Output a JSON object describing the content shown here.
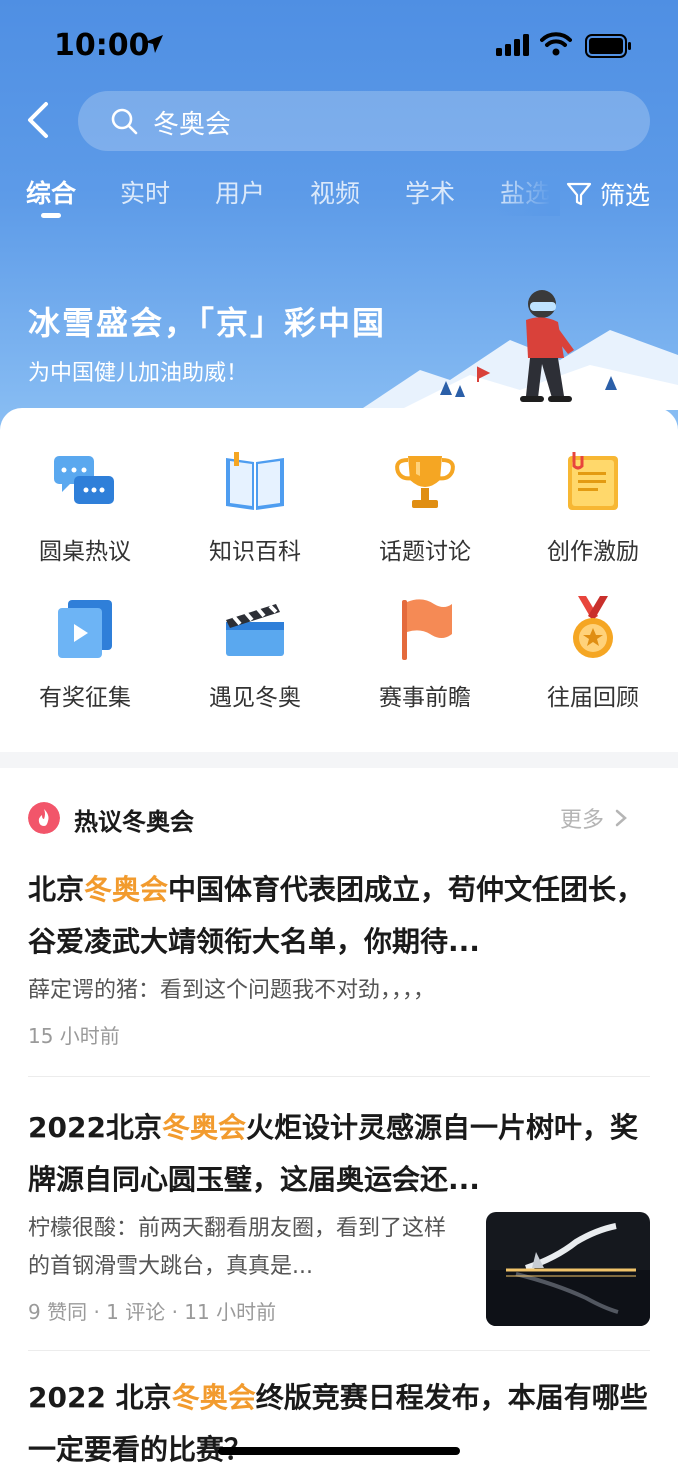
{
  "status_bar": {
    "time": "10:00"
  },
  "search": {
    "query": "冬奥会"
  },
  "tabs": [
    "综合",
    "实时",
    "用户",
    "视频",
    "学术",
    "盐选"
  ],
  "filter_label": "筛选",
  "banner": {
    "title": "冰雪盛会，「京」彩中国",
    "subtitle": "为中国健儿加油助威！"
  },
  "grid": [
    {
      "label": "圆桌热议",
      "icon": "chat-bubbles-icon"
    },
    {
      "label": "知识百科",
      "icon": "open-book-icon"
    },
    {
      "label": "话题讨论",
      "icon": "trophy-icon"
    },
    {
      "label": "创作激励",
      "icon": "notepad-icon"
    },
    {
      "label": "有奖征集",
      "icon": "video-play-icon"
    },
    {
      "label": "遇见冬奥",
      "icon": "clapperboard-icon"
    },
    {
      "label": "赛事前瞻",
      "icon": "flag-icon"
    },
    {
      "label": "往届回顾",
      "icon": "medal-icon"
    }
  ],
  "section": {
    "title": "热议冬奥会",
    "more": "更多"
  },
  "articles": [
    {
      "title_pre": "北京",
      "title_hl": "冬奥会",
      "title_post": "中国体育代表团成立，苟仲文任团长，谷爱凌武大靖领衔大名单，你期待...",
      "excerpt": "薛定谔的猪：看到这个问题我不对劲，，，，",
      "meta": "15 小时前"
    },
    {
      "title_pre": "2022北京",
      "title_hl": "冬奥会",
      "title_post": "火炬设计灵感源自一片树叶，奖牌源自同心圆玉璧，这届奥运会还...",
      "excerpt": "柠檬很酸：前两天翻看朋友圈，看到了这样的首钢滑雪大跳台，真真是...",
      "meta": "9 赞同 · 1 评论 · 11 小时前"
    },
    {
      "title_pre": "2022 北京",
      "title_hl": "冬奥会",
      "title_post": "终版竞赛日程发布，本届有哪些一定要看的比赛？"
    }
  ]
}
